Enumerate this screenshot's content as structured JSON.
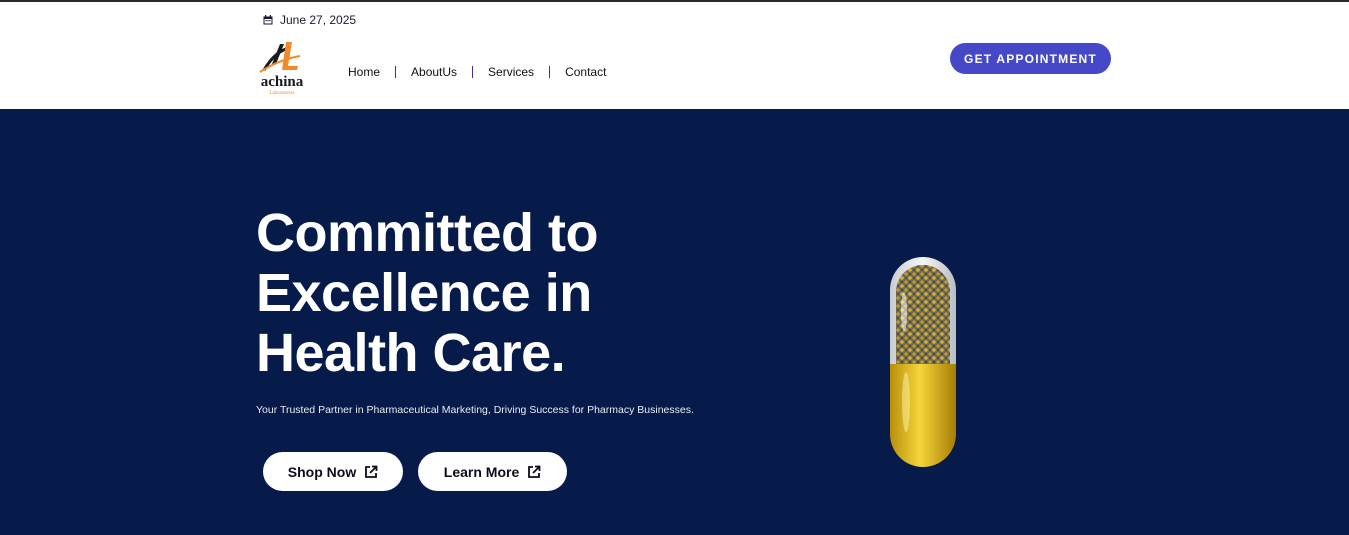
{
  "header": {
    "date": "June 27, 2025",
    "logo": {
      "name": "achina",
      "tagline": "Laboratories"
    },
    "nav": [
      {
        "label": "Home"
      },
      {
        "label": "AboutUs"
      },
      {
        "label": "Services"
      },
      {
        "label": "Contact"
      }
    ],
    "appointment_label": "GET APPOINTMENT"
  },
  "hero": {
    "title_line1": "Committed to",
    "title_line2": "Excellence in",
    "title_line3": "Health Care.",
    "subtitle": "Your Trusted Partner in Pharmaceutical Marketing, Driving Success for Pharmacy Businesses.",
    "shop_label": "Shop Now",
    "learn_label": "Learn More"
  },
  "colors": {
    "hero_bg": "#071b4a",
    "accent": "#4649c7",
    "logo_orange": "#f28a2a"
  },
  "icons": {
    "date": "calendar-icon",
    "button": "external-link-icon",
    "hero_image": "capsule-icon"
  }
}
